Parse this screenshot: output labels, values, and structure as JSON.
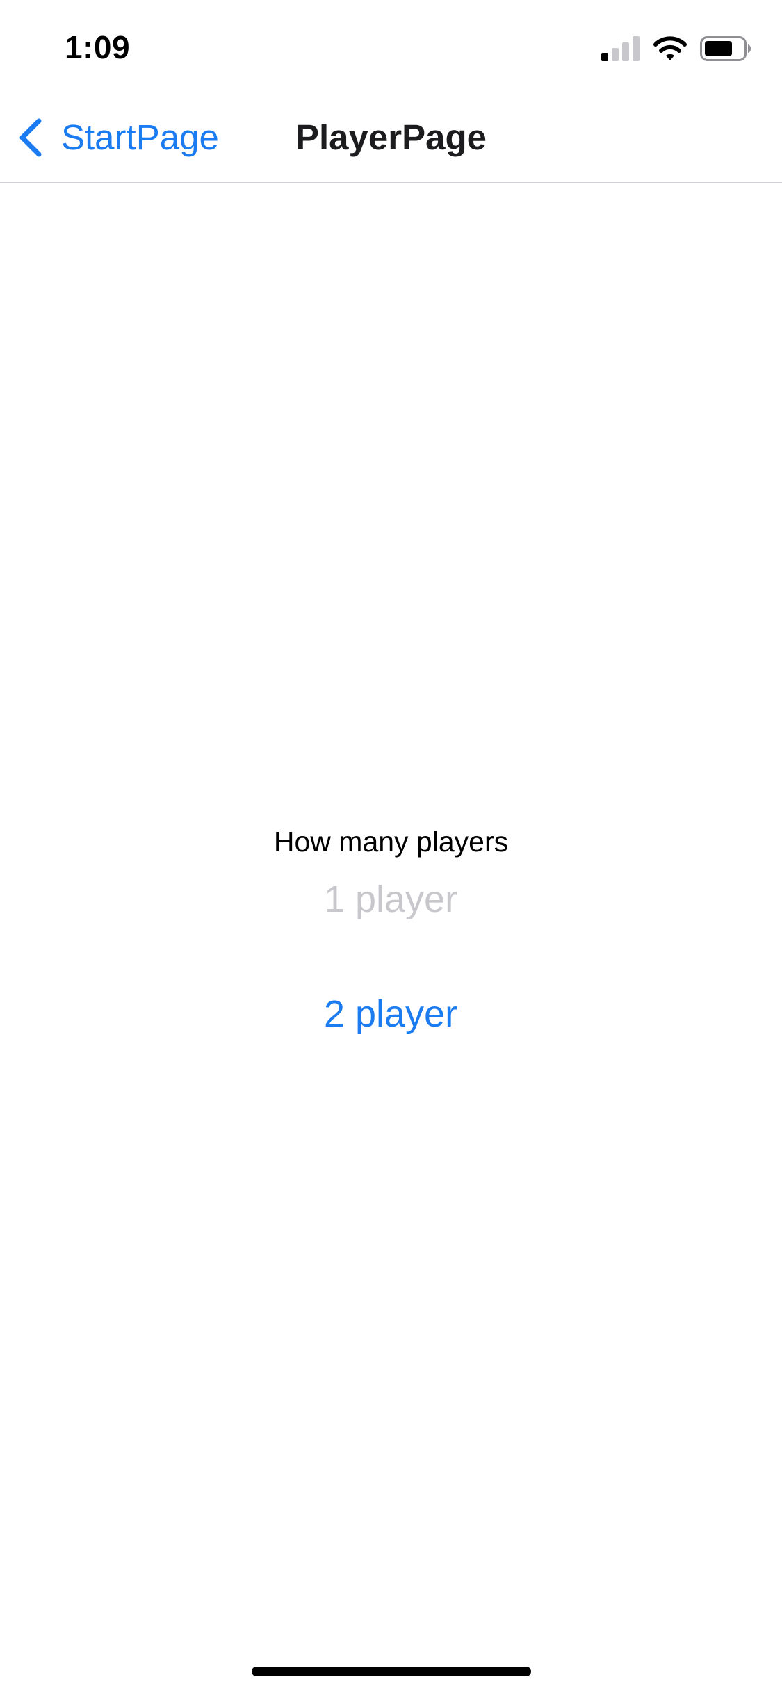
{
  "status_bar": {
    "time": "1:09",
    "icons": [
      "cellular-signal-icon",
      "wifi-icon",
      "battery-icon"
    ]
  },
  "nav": {
    "back_label": "StartPage",
    "title": "PlayerPage"
  },
  "main": {
    "question": "How many players",
    "options": [
      {
        "label": "1 player",
        "state": "disabled"
      },
      {
        "label": "2 player",
        "state": "enabled"
      }
    ]
  },
  "colors": {
    "accent": "#1b7cf2",
    "disabled": "#c7c7cc",
    "text": "#000000",
    "separator": "#d1d1d6",
    "background": "#ffffff"
  }
}
